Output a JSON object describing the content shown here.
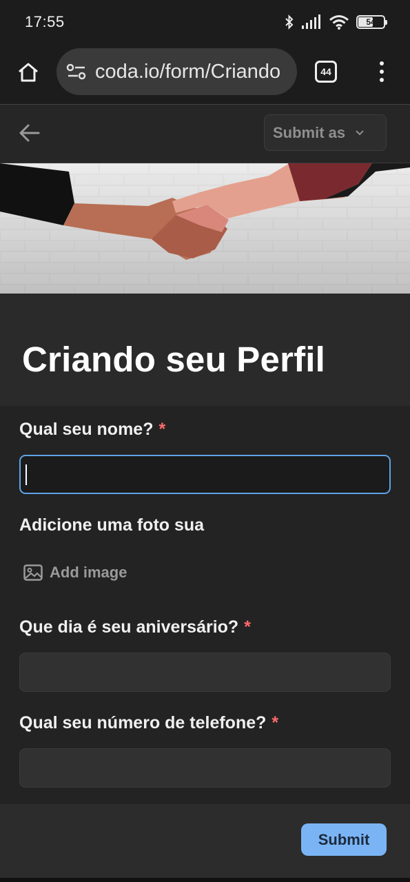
{
  "status_bar": {
    "time": "17:55",
    "battery": "54"
  },
  "browser": {
    "url": "coda.io/form/Criando",
    "tab_count": "44"
  },
  "app_bar": {
    "submit_as_label": "Submit as"
  },
  "form": {
    "title": "Criando seu Perfil",
    "questions": [
      {
        "label": "Qual seu nome?",
        "required": true,
        "value": ""
      },
      {
        "label": "Adicione uma foto sua",
        "required": false,
        "action": "Add image"
      },
      {
        "label": "Que dia é seu aniversário?",
        "required": true,
        "value": ""
      },
      {
        "label": "Qual seu número de telefone?",
        "required": true,
        "value": ""
      }
    ],
    "required_marker": "*",
    "submit_label": "Submit"
  },
  "colors": {
    "accent": "#7ab4f5",
    "focus_border": "#5fa3e8",
    "required": "#ff6a6a",
    "background": "#232323"
  }
}
